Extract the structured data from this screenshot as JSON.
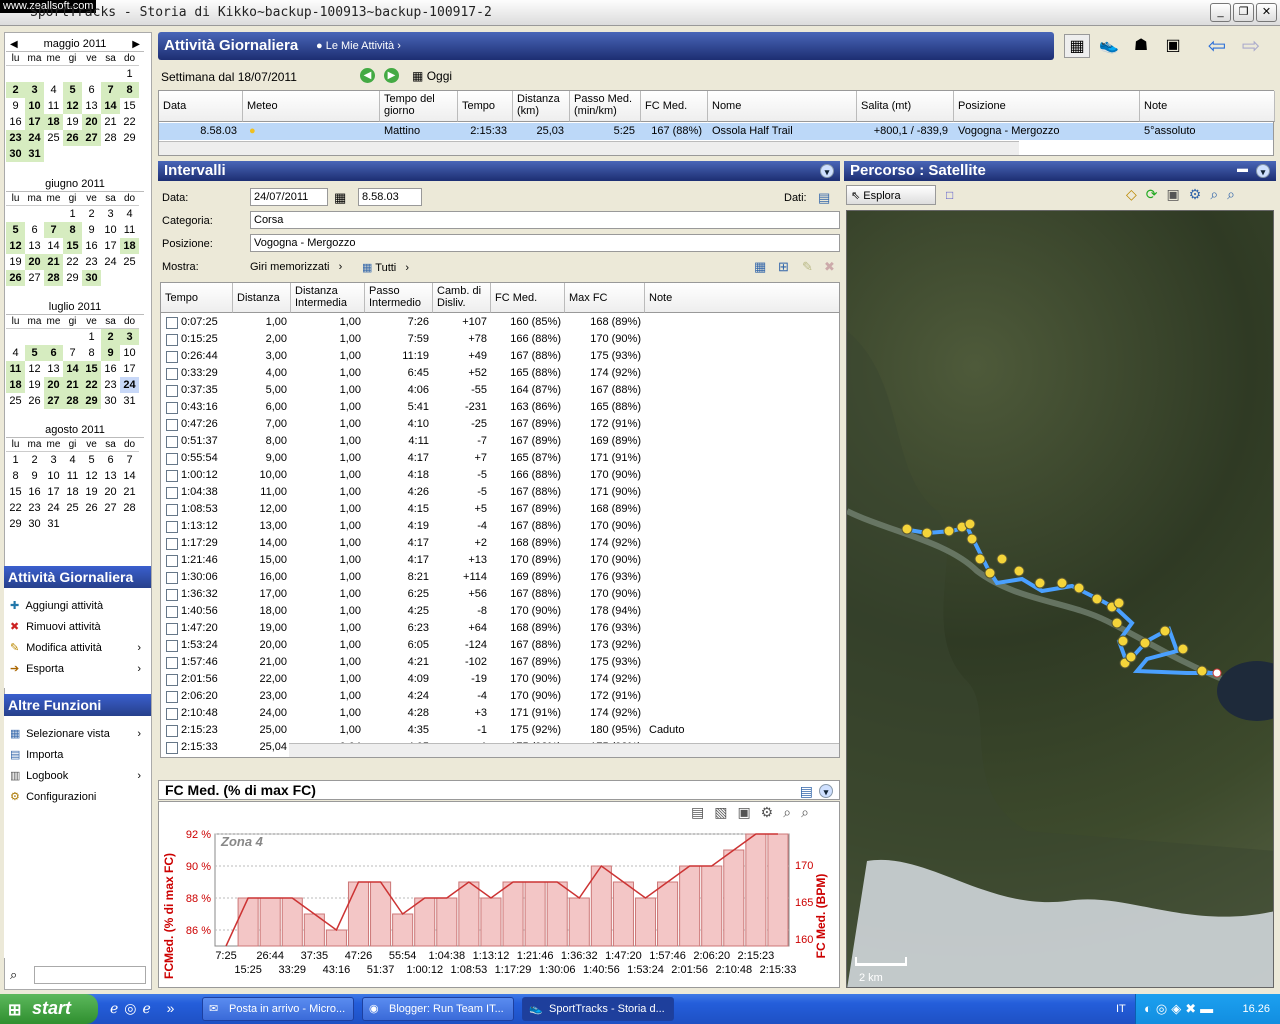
{
  "window": {
    "watermark": "www.zeallsoft.com",
    "title": "SportTracks - Storia di Kikko~backup-100913~backup-100917-2"
  },
  "calendars": [
    {
      "month": "maggio 2011",
      "days": [
        "",
        "",
        "",
        "",
        "",
        "",
        "1",
        "2",
        "3",
        "4",
        "5",
        "6",
        "7",
        "8",
        "9",
        "10",
        "11",
        "12",
        "13",
        "14",
        "15",
        "16",
        "17",
        "18",
        "19",
        "20",
        "21",
        "22",
        "23",
        "24",
        "25",
        "26",
        "27",
        "28",
        "29",
        "30",
        "31"
      ],
      "active": [
        "2",
        "3",
        "5",
        "7",
        "8",
        "10",
        "12",
        "14",
        "17",
        "18",
        "20",
        "23",
        "24",
        "26",
        "27",
        "30",
        "31"
      ]
    },
    {
      "month": "giugno 2011",
      "days": [
        "",
        "",
        "",
        "1",
        "2",
        "3",
        "4",
        "5",
        "6",
        "7",
        "8",
        "9",
        "10",
        "11",
        "12",
        "13",
        "14",
        "15",
        "16",
        "17",
        "18",
        "19",
        "20",
        "21",
        "22",
        "23",
        "24",
        "25",
        "26",
        "27",
        "28",
        "29",
        "30"
      ],
      "active": [
        "5",
        "7",
        "8",
        "12",
        "15",
        "18",
        "20",
        "21",
        "26",
        "28",
        "30"
      ]
    },
    {
      "month": "luglio 2011",
      "days": [
        "",
        "",
        "",
        "",
        "1",
        "2",
        "3",
        "4",
        "5",
        "6",
        "7",
        "8",
        "9",
        "10",
        "11",
        "12",
        "13",
        "14",
        "15",
        "16",
        "17",
        "18",
        "19",
        "20",
        "21",
        "22",
        "23",
        "24",
        "25",
        "26",
        "27",
        "28",
        "29",
        "30",
        "31"
      ],
      "active": [
        "2",
        "3",
        "5",
        "6",
        "9",
        "11",
        "14",
        "15",
        "18",
        "20",
        "21",
        "22",
        "27",
        "28",
        "29"
      ],
      "selected": "24"
    },
    {
      "month": "agosto 2011",
      "days": [
        "1",
        "2",
        "3",
        "4",
        "5",
        "6",
        "7",
        "8",
        "9",
        "10",
        "11",
        "12",
        "13",
        "14",
        "15",
        "16",
        "17",
        "18",
        "19",
        "20",
        "21",
        "22",
        "23",
        "24",
        "25",
        "26",
        "27",
        "28",
        "29",
        "30",
        "31"
      ],
      "active": []
    }
  ],
  "dow": [
    "lu",
    "ma",
    "me",
    "gi",
    "ve",
    "sa",
    "do"
  ],
  "panel_activity": {
    "title": "Attività Giornaliera",
    "items": [
      "Aggiungi attività",
      "Rimuovi attività",
      "Modifica attività",
      "Esporta"
    ]
  },
  "panel_other": {
    "title": "Altre Funzioni",
    "items": [
      "Selezionare vista",
      "Importa",
      "Logbook",
      "Configurazioni"
    ]
  },
  "header": {
    "title": "Attività Giornaliera",
    "crumb": "Le Mie Attività"
  },
  "weekbar": {
    "label": "Settimana dal 18/07/2011",
    "today": "Oggi"
  },
  "activities": {
    "columns": [
      "Data",
      "Meteo",
      "Tempo del giorno",
      "Tempo",
      "Distanza (km)",
      "Passo Med. (min/km)",
      "FC Med.",
      "Nome",
      "Salita (mt)",
      "Posizione",
      "Note"
    ],
    "rows": [
      [
        "8.58.03",
        "",
        "Mattino",
        "2:15:33",
        "25,03",
        "5:25",
        "167 (88%)",
        "Ossola Half Trail",
        "+800,1 / -839,9",
        "Vogogna - Mergozzo",
        "5°assoluto"
      ]
    ]
  },
  "intervals": {
    "title": "Intervalli",
    "data_label": "Data:",
    "date": "24/07/2011",
    "time": "8.58.03",
    "dati_label": "Dati:",
    "categoria_label": "Categoria:",
    "categoria": "Corsa",
    "posizione_label": "Posizione:",
    "posizione": "Vogogna - Mergozzo",
    "mostra_label": "Mostra:",
    "mostra": "Giri memorizzati",
    "tutti": "Tutti",
    "columns": [
      "Tempo",
      "Distanza",
      "Distanza Intermedia",
      "Passo Intermedio",
      "Camb. di Disliv.",
      "FC Med.",
      "Max FC",
      "Note"
    ],
    "rows": [
      [
        "0:07:25",
        "1,00",
        "1,00",
        "7:26",
        "+107",
        "160 (85%)",
        "168 (89%)",
        ""
      ],
      [
        "0:15:25",
        "2,00",
        "1,00",
        "7:59",
        "+78",
        "166 (88%)",
        "170 (90%)",
        ""
      ],
      [
        "0:26:44",
        "3,00",
        "1,00",
        "11:19",
        "+49",
        "167 (88%)",
        "175 (93%)",
        ""
      ],
      [
        "0:33:29",
        "4,00",
        "1,00",
        "6:45",
        "+52",
        "165 (88%)",
        "174 (92%)",
        ""
      ],
      [
        "0:37:35",
        "5,00",
        "1,00",
        "4:06",
        "-55",
        "164 (87%)",
        "167 (88%)",
        ""
      ],
      [
        "0:43:16",
        "6,00",
        "1,00",
        "5:41",
        "-231",
        "163 (86%)",
        "165 (88%)",
        ""
      ],
      [
        "0:47:26",
        "7,00",
        "1,00",
        "4:10",
        "-25",
        "167 (89%)",
        "172 (91%)",
        ""
      ],
      [
        "0:51:37",
        "8,00",
        "1,00",
        "4:11",
        "-7",
        "167 (89%)",
        "169 (89%)",
        ""
      ],
      [
        "0:55:54",
        "9,00",
        "1,00",
        "4:17",
        "+7",
        "165 (87%)",
        "171 (91%)",
        ""
      ],
      [
        "1:00:12",
        "10,00",
        "1,00",
        "4:18",
        "-5",
        "166 (88%)",
        "170 (90%)",
        ""
      ],
      [
        "1:04:38",
        "11,00",
        "1,00",
        "4:26",
        "-5",
        "167 (88%)",
        "171 (90%)",
        ""
      ],
      [
        "1:08:53",
        "12,00",
        "1,00",
        "4:15",
        "+5",
        "167 (89%)",
        "168 (89%)",
        ""
      ],
      [
        "1:13:12",
        "13,00",
        "1,00",
        "4:19",
        "-4",
        "167 (88%)",
        "170 (90%)",
        ""
      ],
      [
        "1:17:29",
        "14,00",
        "1,00",
        "4:17",
        "+2",
        "168 (89%)",
        "174 (92%)",
        ""
      ],
      [
        "1:21:46",
        "15,00",
        "1,00",
        "4:17",
        "+13",
        "170 (89%)",
        "170 (90%)",
        ""
      ],
      [
        "1:30:06",
        "16,00",
        "1,00",
        "8:21",
        "+114",
        "169 (89%)",
        "176 (93%)",
        ""
      ],
      [
        "1:36:32",
        "17,00",
        "1,00",
        "6:25",
        "+56",
        "167 (88%)",
        "170 (90%)",
        ""
      ],
      [
        "1:40:56",
        "18,00",
        "1,00",
        "4:25",
        "-8",
        "170 (90%)",
        "178 (94%)",
        ""
      ],
      [
        "1:47:20",
        "19,00",
        "1,00",
        "6:23",
        "+64",
        "168 (89%)",
        "176 (93%)",
        ""
      ],
      [
        "1:53:24",
        "20,00",
        "1,00",
        "6:05",
        "-124",
        "167 (88%)",
        "173 (92%)",
        ""
      ],
      [
        "1:57:46",
        "21,00",
        "1,00",
        "4:21",
        "-102",
        "167 (89%)",
        "175 (93%)",
        ""
      ],
      [
        "2:01:56",
        "22,00",
        "1,00",
        "4:09",
        "-19",
        "170 (90%)",
        "174 (92%)",
        ""
      ],
      [
        "2:06:20",
        "23,00",
        "1,00",
        "4:24",
        "-4",
        "170 (90%)",
        "172 (91%)",
        ""
      ],
      [
        "2:10:48",
        "24,00",
        "1,00",
        "4:28",
        "+3",
        "171 (91%)",
        "174 (92%)",
        ""
      ],
      [
        "2:15:23",
        "25,00",
        "1,00",
        "4:35",
        "-1",
        "175 (92%)",
        "180 (95%)",
        "Caduto"
      ],
      [
        "2:15:33",
        "25,04",
        "0,04",
        "4:05",
        "-1",
        "175 (92%)",
        "175 (93%)",
        ""
      ]
    ]
  },
  "chart_data": {
    "type": "bar",
    "title": "FC Med. (% di max FC)",
    "zone_label": "Zona 4",
    "ylabel": "FCMed. (% di max FC)",
    "y2label": "FC Med. (BPM)",
    "x": [
      "7:25",
      "15:25",
      "26:44",
      "33:29",
      "37:35",
      "43:16",
      "47:26",
      "51:37",
      "55:54",
      "1:00:12",
      "1:04:38",
      "1:08:53",
      "1:13:12",
      "1:17:29",
      "1:21:46",
      "1:30:06",
      "1:36:32",
      "1:40:56",
      "1:47:20",
      "1:53:24",
      "1:57:46",
      "2:01:56",
      "2:06:20",
      "2:10:48",
      "2:15:23",
      "2:15:33"
    ],
    "values": [
      85,
      88,
      88,
      88,
      87,
      86,
      89,
      89,
      87,
      88,
      88,
      89,
      88,
      89,
      89,
      89,
      88,
      90,
      89,
      88,
      89,
      90,
      90,
      91,
      92,
      92
    ],
    "yticks_left": [
      "92 %",
      "90 %",
      "88 %",
      "86 %"
    ],
    "yticks_right": [
      "170",
      "165",
      "160"
    ],
    "ylim": [
      85,
      92
    ]
  },
  "map": {
    "title": "Percorso  : Satellite",
    "explore": "Esplora",
    "scale": "2 km"
  },
  "taskbar": {
    "start": "start",
    "tasks": [
      "Posta in arrivo - Micro...",
      "Blogger: Run Team IT...",
      "SportTracks - Storia d..."
    ],
    "lang": "IT",
    "clock": "16.26"
  }
}
